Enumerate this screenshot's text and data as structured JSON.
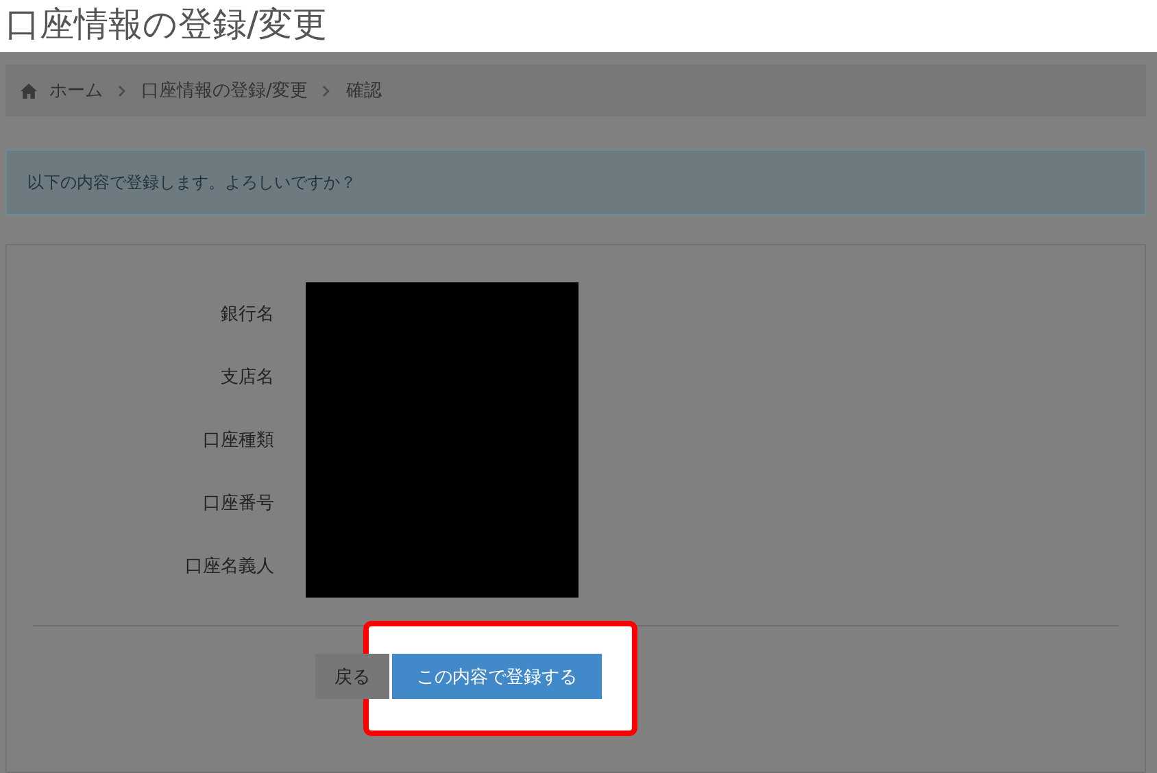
{
  "page_title": "口座情報の登録/変更",
  "breadcrumb": [
    {
      "label": "ホーム",
      "kind": "home"
    },
    {
      "label": "口座情報の登録/変更",
      "kind": "link"
    },
    {
      "label": "確認",
      "kind": "current"
    }
  ],
  "alert": "以下の内容で登録します。よろしいですか？",
  "fields": [
    {
      "label": "銀行名"
    },
    {
      "label": "支店名"
    },
    {
      "label": "口座種類"
    },
    {
      "label": "口座番号"
    },
    {
      "label": "口座名義人"
    }
  ],
  "buttons": [
    {
      "label": "戻る",
      "kind": "back"
    },
    {
      "label": "この内容で登録する",
      "kind": "primary",
      "highlighted": true
    }
  ]
}
